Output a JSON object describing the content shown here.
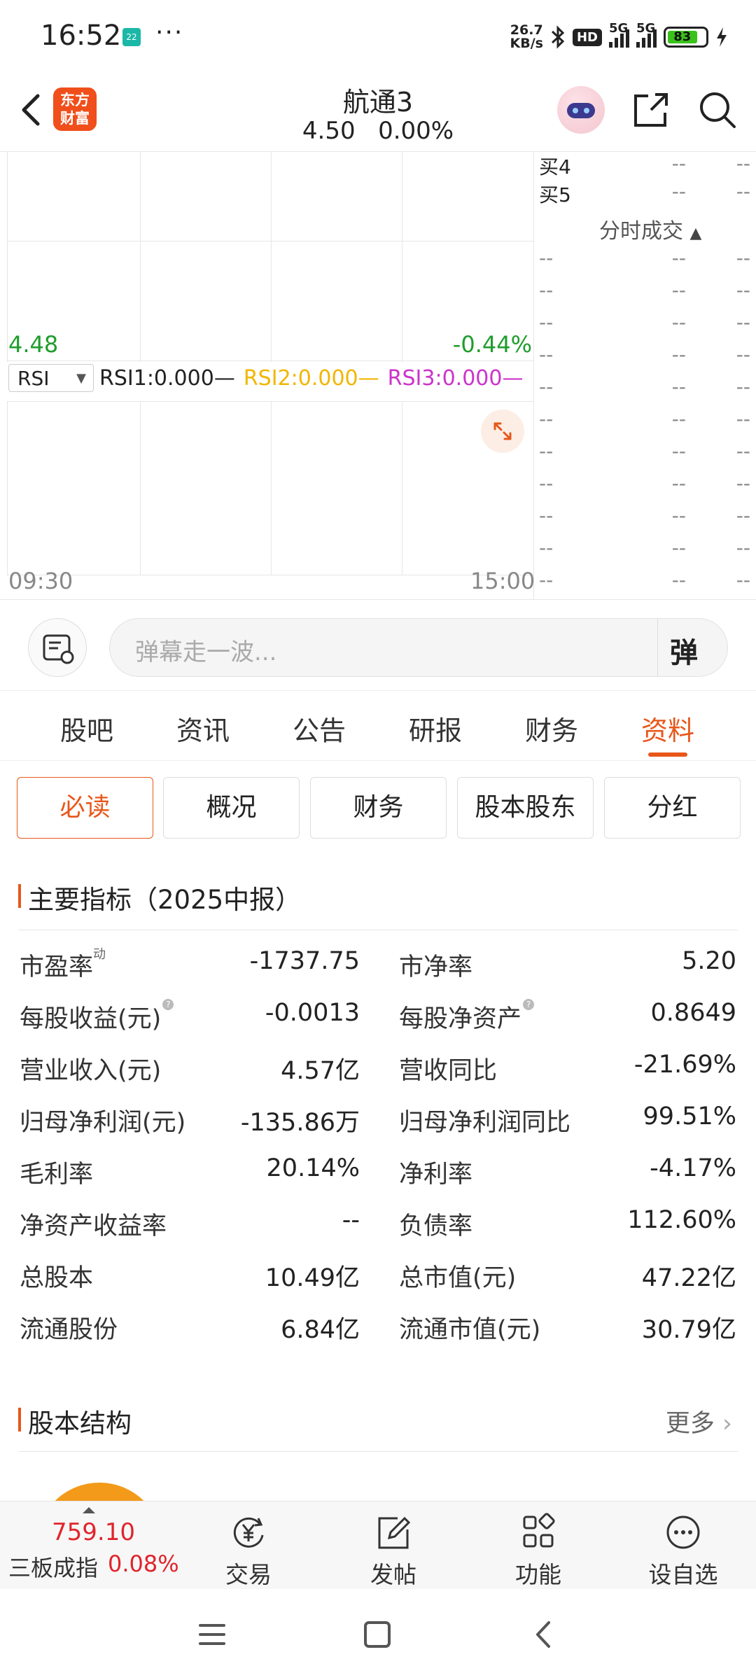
{
  "status": {
    "time": "16:52",
    "app_badge": "22",
    "dots": "···",
    "net_speed_top": "26.7",
    "net_speed_bottom": "KB/s",
    "hd": "HD",
    "net1": "5G",
    "net2": "5G",
    "battery": "83"
  },
  "header": {
    "title": "航通3",
    "price": "4.50",
    "change": "0.00%",
    "logo_line1": "东方",
    "logo_line2": "财富"
  },
  "chart": {
    "price_low": "4.48",
    "pct_low": "-0.44%",
    "indicator": "RSI",
    "rsi1": "RSI1:0.000—",
    "rsi2": "RSI2:0.000—",
    "rsi3": "RSI3:0.000—",
    "time_start": "09:30",
    "time_end": "15:00",
    "colors": {
      "rsi1": "#222222",
      "rsi2": "#f2b600",
      "rsi3": "#cc33cc"
    }
  },
  "order_book": {
    "bids": [
      {
        "label": "买4",
        "price": "--",
        "vol": "--"
      },
      {
        "label": "买5",
        "price": "--",
        "vol": "--"
      }
    ],
    "ticks_title": "分时成交",
    "ticks": [
      "--",
      "--",
      "--",
      "--",
      "--",
      "--",
      "--",
      "--",
      "--",
      "--",
      "--"
    ]
  },
  "danmu": {
    "placeholder": "弹幕走一波...",
    "send_label": "弹"
  },
  "tabs": [
    "股吧",
    "资讯",
    "公告",
    "研报",
    "财务",
    "资料"
  ],
  "active_tab": "资料",
  "subtabs": [
    "必读",
    "概况",
    "财务",
    "股本股东",
    "分红"
  ],
  "metrics_section": {
    "title": "主要指标（2025中报）",
    "rows": [
      {
        "l1": "市盈率",
        "l1_sup": "动",
        "v1": "-1737.75",
        "l2": "市净率",
        "v2": "5.20"
      },
      {
        "l1": "每股收益(元)",
        "v1": "-0.0013",
        "l2": "每股净资产",
        "v2": "0.8649"
      },
      {
        "l1": "营业收入(元)",
        "v1": "4.57亿",
        "l2": "营收同比",
        "v2": "-21.69%"
      },
      {
        "l1": "归母净利润(元)",
        "v1": "-135.86万",
        "l2": "归母净利润同比",
        "v2": "99.51%"
      },
      {
        "l1": "毛利率",
        "v1": "20.14%",
        "l2": "净利率",
        "v2": "-4.17%"
      },
      {
        "l1": "净资产收益率",
        "v1": "--",
        "l2": "负债率",
        "v2": "112.60%"
      },
      {
        "l1": "总股本",
        "v1": "10.49亿",
        "l2": "总市值(元)",
        "v2": "47.22亿"
      },
      {
        "l1": "流通股份",
        "v1": "6.84亿",
        "l2": "流通市值(元)",
        "v2": "30.79亿"
      }
    ]
  },
  "share_section": {
    "title": "股本结构",
    "more": "更多"
  },
  "bottom_bar": {
    "index_value": "759.10",
    "index_name": "三板成指",
    "index_pct": "0.08%",
    "items": [
      "交易",
      "发帖",
      "功能",
      "设自选"
    ]
  }
}
